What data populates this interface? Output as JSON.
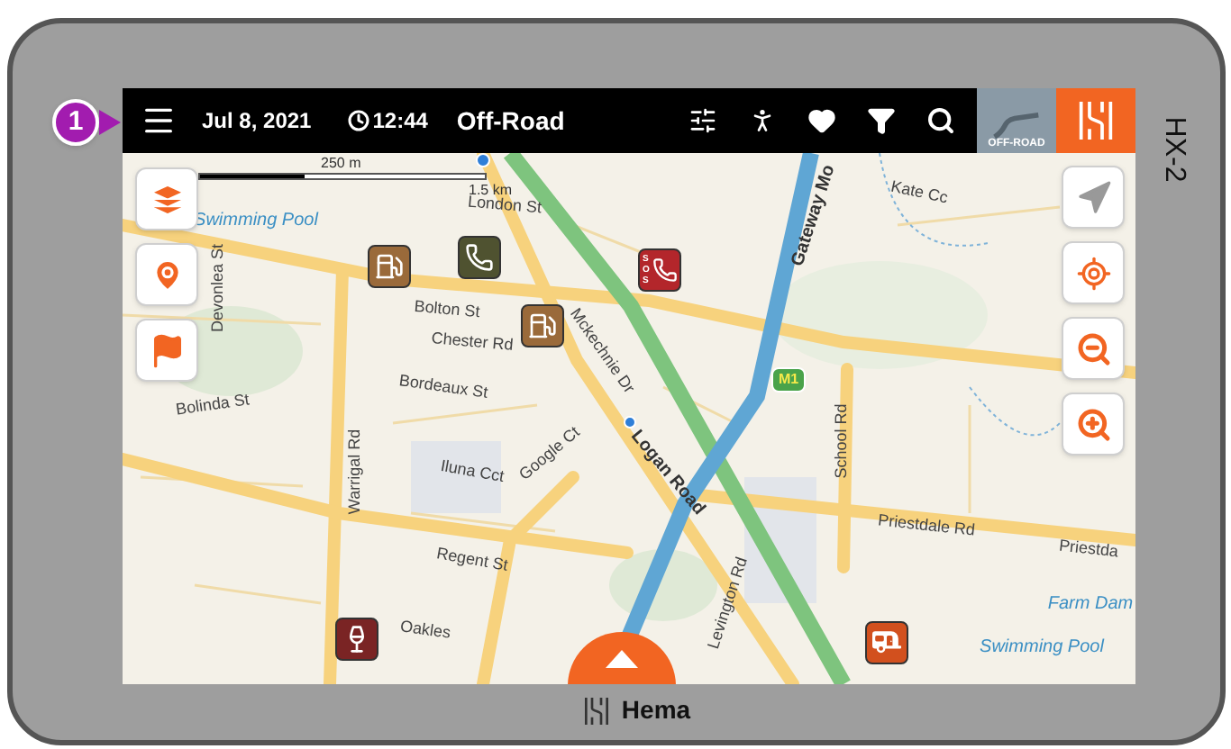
{
  "callout": {
    "label": "1"
  },
  "device": {
    "model": "HX-2",
    "brand": "Hema"
  },
  "top_bar": {
    "date": "Jul 8, 2021",
    "time": "12:44",
    "mode": "Off-Road",
    "map_mode_badge": "OFF-ROAD"
  },
  "map": {
    "scale_labels": [
      "250 m",
      "1.5 km"
    ],
    "road_shield": "M1",
    "labels": [
      {
        "text": "Swimming Pool",
        "kind": "water"
      },
      {
        "text": "London St",
        "kind": "street"
      },
      {
        "text": "Bolton St",
        "kind": "street"
      },
      {
        "text": "Chester Rd",
        "kind": "street"
      },
      {
        "text": "Bordeaux St",
        "kind": "street"
      },
      {
        "text": "Bolinda St",
        "kind": "street"
      },
      {
        "text": "Devonlea St",
        "kind": "street"
      },
      {
        "text": "Warrigal Rd",
        "kind": "street"
      },
      {
        "text": "Logan Road",
        "kind": "main"
      },
      {
        "text": "Gateway Mo",
        "kind": "main"
      },
      {
        "text": "Kate Cc",
        "kind": "street"
      },
      {
        "text": "School Rd",
        "kind": "street"
      },
      {
        "text": "Priestdale Rd",
        "kind": "street"
      },
      {
        "text": "Priestda",
        "kind": "street"
      },
      {
        "text": "Farm Dam",
        "kind": "water"
      },
      {
        "text": "Swimming Pool",
        "kind": "water"
      },
      {
        "text": "Levington Rd",
        "kind": "street"
      },
      {
        "text": "Oakles",
        "kind": "street"
      },
      {
        "text": "Iluna Cct",
        "kind": "street"
      },
      {
        "text": "Google Ct",
        "kind": "street"
      },
      {
        "text": "Regent St",
        "kind": "street"
      },
      {
        "text": "Mckechnie Dr",
        "kind": "street"
      }
    ],
    "pins": [
      {
        "kind": "fuel",
        "color": "#9a6a3a"
      },
      {
        "kind": "phone",
        "color": "#4f5230"
      },
      {
        "kind": "sos",
        "color": "#b3262b",
        "text": "SOS"
      },
      {
        "kind": "fuel",
        "color": "#9a6a3a"
      },
      {
        "kind": "wine",
        "color": "#7a2424"
      },
      {
        "kind": "caravan",
        "color": "#d2501e"
      }
    ]
  }
}
